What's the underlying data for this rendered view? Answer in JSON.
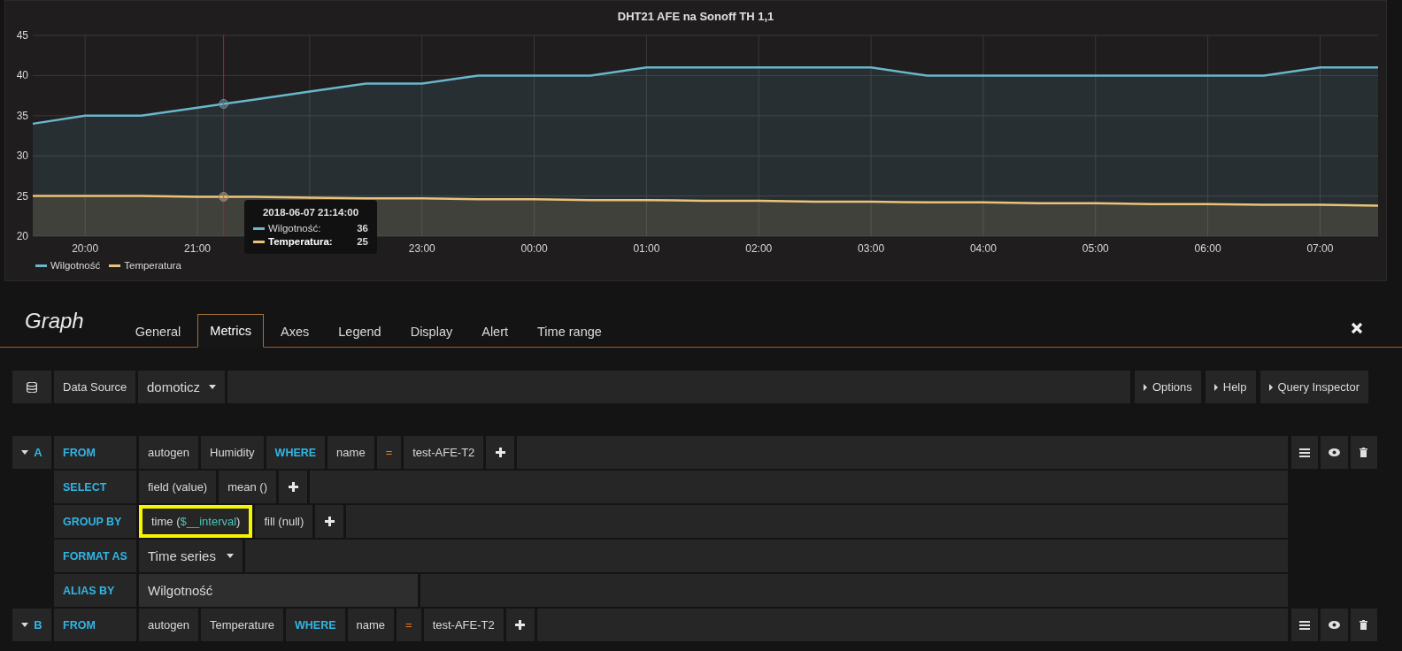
{
  "panel": {
    "title": "DHT21 AFE na Sonoff TH 1,1",
    "chart_data": {
      "type": "area",
      "grid": true,
      "xlim": [
        "2018-06-07 19:32",
        "2018-06-08 07:31"
      ],
      "ylim": [
        20,
        45
      ],
      "yticks": [
        20,
        25,
        30,
        35,
        40,
        45
      ],
      "xticks": [
        {
          "value": "2018-06-07 20:00",
          "label": "20:00"
        },
        {
          "value": "2018-06-07 21:00",
          "label": "21:00"
        },
        {
          "value": "2018-06-07 23:00",
          "label": "23:00"
        },
        {
          "value": "2018-06-08 00:00",
          "label": "00:00"
        },
        {
          "value": "2018-06-08 01:00",
          "label": "01:00"
        },
        {
          "value": "2018-06-08 02:00",
          "label": "02:00"
        },
        {
          "value": "2018-06-08 03:00",
          "label": "03:00"
        },
        {
          "value": "2018-06-08 04:00",
          "label": "04:00"
        },
        {
          "value": "2018-06-08 05:00",
          "label": "05:00"
        },
        {
          "value": "2018-06-08 06:00",
          "label": "06:00"
        },
        {
          "value": "2018-06-08 07:00",
          "label": "07:00"
        }
      ],
      "x": [
        "2018-06-07 19:32",
        "2018-06-07 20:00",
        "2018-06-07 20:30",
        "2018-06-07 21:00",
        "2018-06-07 21:30",
        "2018-06-07 22:00",
        "2018-06-07 22:30",
        "2018-06-07 23:00",
        "2018-06-07 23:30",
        "2018-06-08 00:00",
        "2018-06-08 00:30",
        "2018-06-08 01:00",
        "2018-06-08 01:30",
        "2018-06-08 02:00",
        "2018-06-08 02:30",
        "2018-06-08 03:00",
        "2018-06-08 03:30",
        "2018-06-08 04:00",
        "2018-06-08 04:30",
        "2018-06-08 05:00",
        "2018-06-08 05:30",
        "2018-06-08 06:00",
        "2018-06-08 06:30",
        "2018-06-08 07:00",
        "2018-06-08 07:31"
      ],
      "series": [
        {
          "name": "Wilgotność",
          "color": "#6ab7cc",
          "values": [
            34,
            35,
            35,
            36,
            37,
            38,
            39,
            39,
            40,
            40,
            40,
            41,
            41,
            41,
            41,
            41,
            40,
            40,
            40,
            40,
            40,
            40,
            40,
            41,
            41
          ]
        },
        {
          "name": "Temperatura",
          "color": "#eac37a",
          "values": [
            25,
            25,
            25,
            24.9,
            24.9,
            24.8,
            24.7,
            24.7,
            24.6,
            24.6,
            24.5,
            24.5,
            24.4,
            24.4,
            24.3,
            24.3,
            24.2,
            24.2,
            24.1,
            24.1,
            24,
            24,
            23.9,
            23.9,
            23.8
          ]
        }
      ],
      "ref_lines": [
        {
          "axis": "x",
          "value": "2018-06-07 21:14",
          "color": "#c4162a"
        }
      ]
    },
    "tooltip": {
      "time": "2018-06-07 21:14:00",
      "rows": [
        {
          "label": "Wilgotność:",
          "value": "36",
          "color": "#6ab7cc",
          "highlighted": false
        },
        {
          "label": "Temperatura:",
          "value": "25",
          "color": "#eac37a",
          "highlighted": true
        }
      ]
    }
  },
  "editor": {
    "title": "Graph",
    "tabs": [
      {
        "label": "General",
        "selected": false
      },
      {
        "label": "Metrics",
        "selected": true
      },
      {
        "label": "Axes",
        "selected": false
      },
      {
        "label": "Legend",
        "selected": false
      },
      {
        "label": "Display",
        "selected": false
      },
      {
        "label": "Alert",
        "selected": false
      },
      {
        "label": "Time range",
        "selected": false
      }
    ],
    "datasource": {
      "label": "Data Source",
      "value": "domoticz"
    },
    "buttons": [
      "Options",
      "Help",
      "Query Inspector"
    ],
    "queries": [
      {
        "letter": "A",
        "rows": [
          {
            "keyword": "FROM",
            "parts": [
              {
                "kind": "segment",
                "pieces": [
                  {
                    "text": "autogen",
                    "variable": false
                  }
                ]
              },
              {
                "kind": "segment",
                "pieces": [
                  {
                    "text": "Humidity",
                    "variable": false
                  }
                ]
              },
              {
                "kind": "keyword",
                "pieces": [
                  {
                    "text": "WHERE",
                    "variable": false
                  }
                ]
              },
              {
                "kind": "segment",
                "pieces": [
                  {
                    "text": "name",
                    "variable": false
                  }
                ]
              },
              {
                "kind": "operator",
                "pieces": [
                  {
                    "text": "=",
                    "variable": false
                  }
                ]
              },
              {
                "kind": "segment",
                "pieces": [
                  {
                    "text": "test-AFE-T2",
                    "variable": false
                  }
                ]
              },
              {
                "kind": "add"
              }
            ]
          },
          {
            "keyword": "SELECT",
            "parts": [
              {
                "kind": "segment",
                "pieces": [
                  {
                    "text": "field (value)",
                    "variable": false
                  }
                ]
              },
              {
                "kind": "segment",
                "pieces": [
                  {
                    "text": "mean ()",
                    "variable": false
                  }
                ]
              },
              {
                "kind": "add"
              }
            ]
          },
          {
            "keyword": "GROUP BY",
            "parts": [
              {
                "kind": "segment",
                "highlighted": true,
                "pieces": [
                  {
                    "text": "time (",
                    "variable": false
                  },
                  {
                    "text": "$__interval",
                    "variable": true
                  },
                  {
                    "text": ")",
                    "variable": false
                  }
                ]
              },
              {
                "kind": "segment",
                "pieces": [
                  {
                    "text": "fill (null)",
                    "variable": false
                  }
                ]
              },
              {
                "kind": "add"
              }
            ]
          },
          {
            "keyword": "FORMAT AS",
            "parts": [
              {
                "kind": "dropdown",
                "pieces": [
                  {
                    "text": "Time series",
                    "variable": false
                  }
                ]
              }
            ]
          },
          {
            "keyword": "ALIAS BY",
            "parts": [
              {
                "kind": "input",
                "pieces": [
                  {
                    "text": "Wilgotność",
                    "variable": false
                  }
                ]
              }
            ]
          }
        ]
      },
      {
        "letter": "B",
        "rows": [
          {
            "keyword": "FROM",
            "parts": [
              {
                "kind": "segment",
                "pieces": [
                  {
                    "text": "autogen",
                    "variable": false
                  }
                ]
              },
              {
                "kind": "segment",
                "pieces": [
                  {
                    "text": "Temperature",
                    "variable": false
                  }
                ]
              },
              {
                "kind": "keyword",
                "pieces": [
                  {
                    "text": "WHERE",
                    "variable": false
                  }
                ]
              },
              {
                "kind": "segment",
                "pieces": [
                  {
                    "text": "name",
                    "variable": false
                  }
                ]
              },
              {
                "kind": "operator",
                "pieces": [
                  {
                    "text": "=",
                    "variable": false
                  }
                ]
              },
              {
                "kind": "segment",
                "pieces": [
                  {
                    "text": "test-AFE-T2",
                    "variable": false
                  }
                ]
              },
              {
                "kind": "add"
              }
            ]
          }
        ]
      }
    ]
  }
}
